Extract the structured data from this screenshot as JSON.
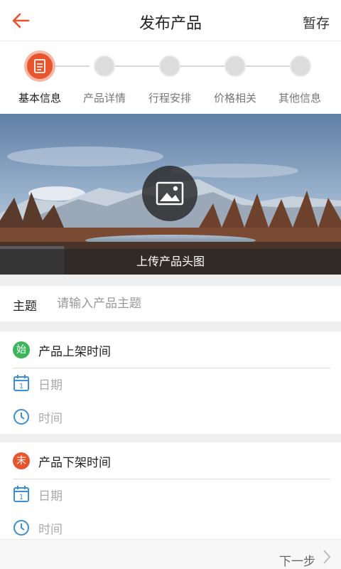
{
  "header": {
    "title": "发布产品",
    "save_label": "暂存"
  },
  "steps": [
    {
      "label": "基本信息",
      "active": true
    },
    {
      "label": "产品详情",
      "active": false
    },
    {
      "label": "行程安排",
      "active": false
    },
    {
      "label": "价格相关",
      "active": false
    },
    {
      "label": "其他信息",
      "active": false
    }
  ],
  "banner": {
    "caption": "上传产品头图"
  },
  "subject": {
    "label": "主题",
    "placeholder": "请输入产品主题",
    "value": ""
  },
  "on_shelf": {
    "badge": "始",
    "title": "产品上架时间",
    "date_placeholder": "日期",
    "time_placeholder": "时间"
  },
  "off_shelf": {
    "badge": "末",
    "title": "产品下架时间",
    "date_placeholder": "日期",
    "time_placeholder": "时间"
  },
  "footer": {
    "next_label": "下一步"
  },
  "colors": {
    "accent": "#e8542b",
    "start_badge": "#3bb55a",
    "end_badge": "#e8542b",
    "icon_blue": "#3a8fd8"
  }
}
